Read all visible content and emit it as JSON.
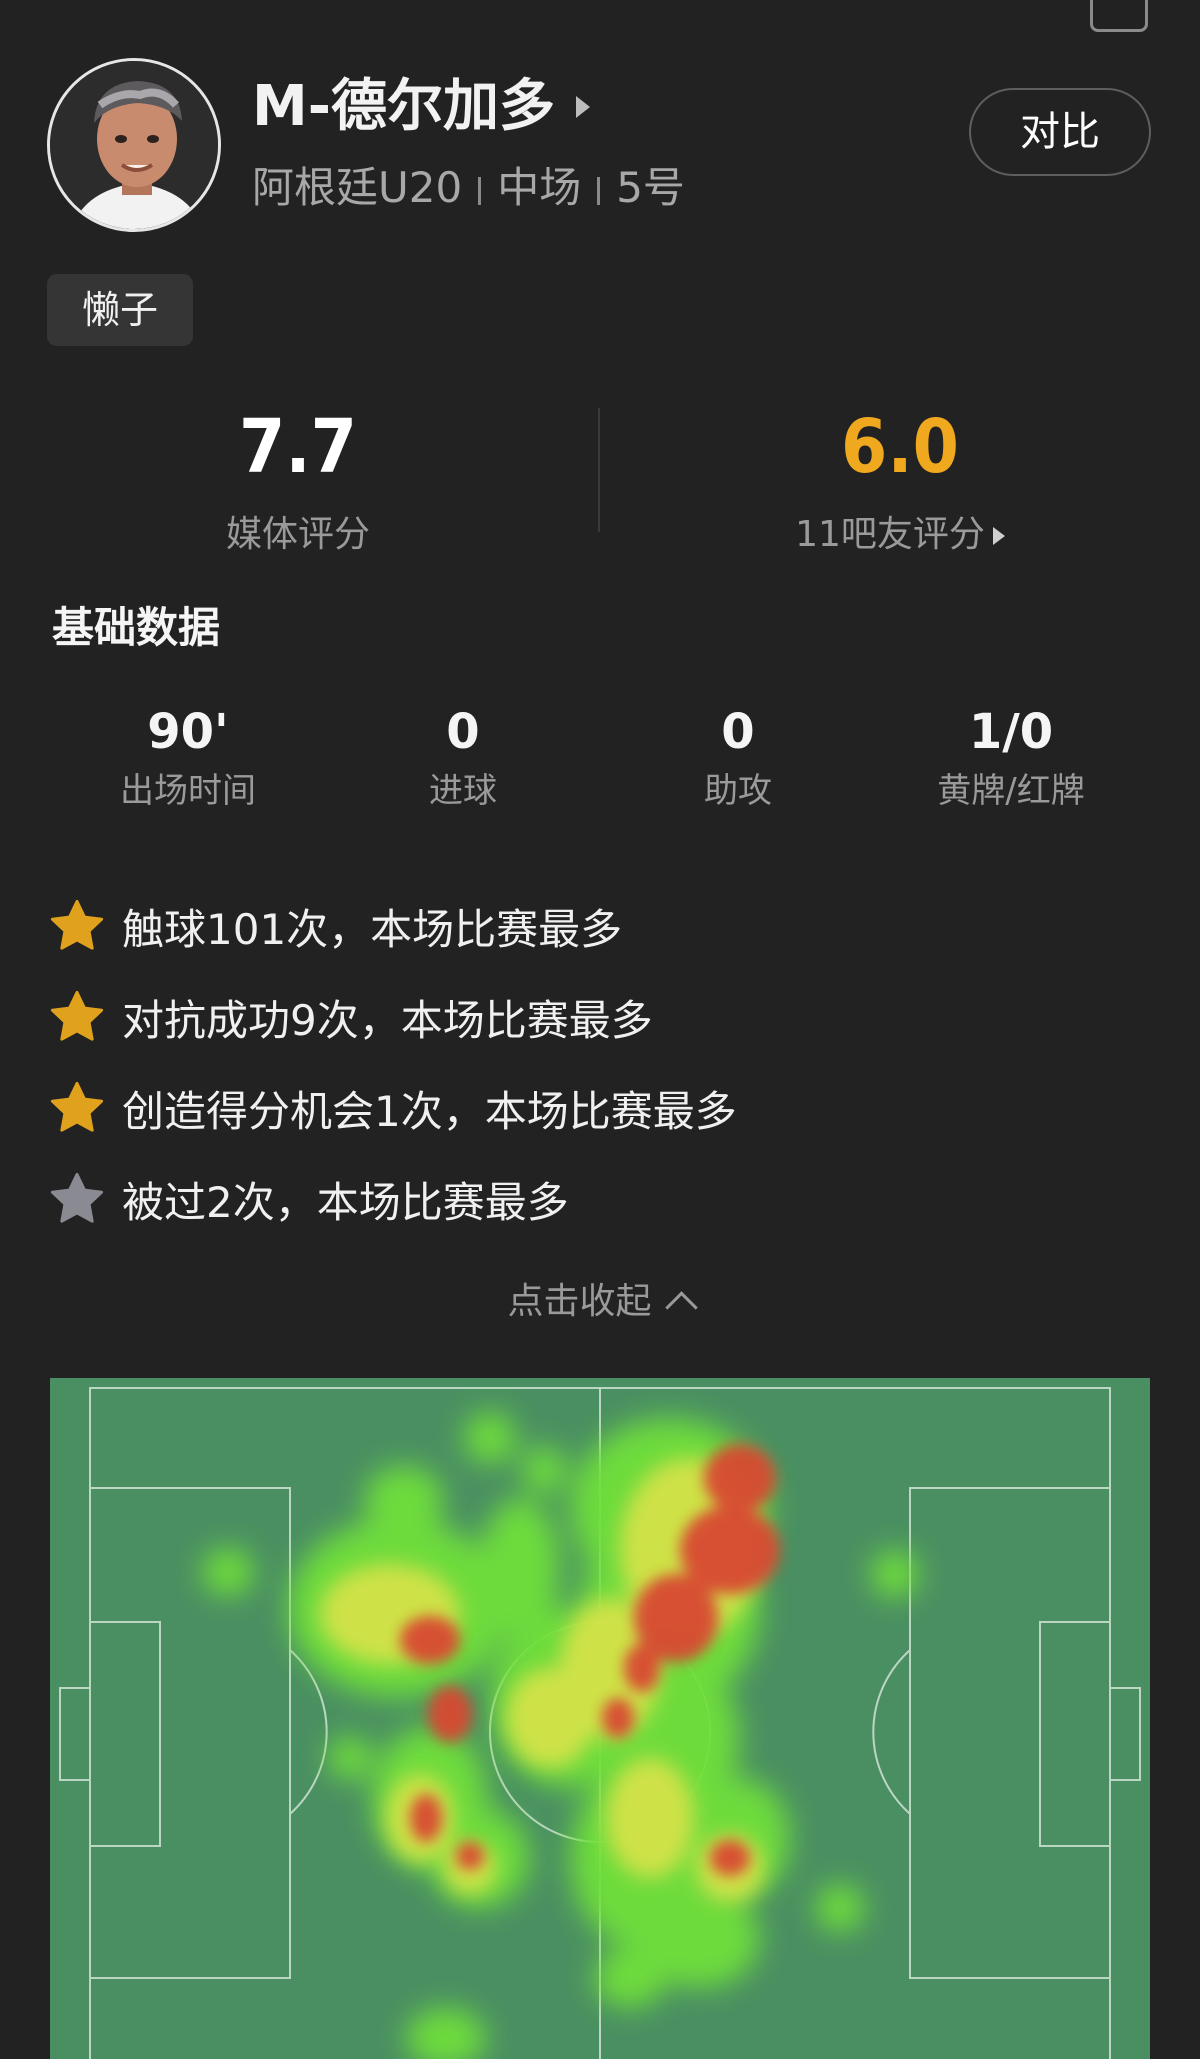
{
  "player": {
    "name": "M-德尔加多",
    "team": "阿根廷U20",
    "position": "中场",
    "number": "5号",
    "nickname": "懒子"
  },
  "actions": {
    "compare_label": "对比"
  },
  "ratings": {
    "media": {
      "value": "7.7",
      "label": "媒体评分",
      "color": "#ffffff"
    },
    "fans": {
      "value": "6.0",
      "label": "11吧友评分",
      "color": "#f0a81e"
    }
  },
  "basic": {
    "title": "基础数据",
    "stats": [
      {
        "value": "90'",
        "label": "出场时间"
      },
      {
        "value": "0",
        "label": "进球"
      },
      {
        "value": "0",
        "label": "助攻"
      },
      {
        "value": "1/0",
        "label": "黄牌/红牌"
      }
    ]
  },
  "highlights": [
    {
      "icon": "gold-star-icon",
      "color": "#e0a21c",
      "text": "触球101次，本场比赛最多"
    },
    {
      "icon": "gold-star-icon",
      "color": "#e0a21c",
      "text": "对抗成功9次，本场比赛最多"
    },
    {
      "icon": "gold-star-icon",
      "color": "#e0a21c",
      "text": "创造得分机会1次，本场比赛最多"
    },
    {
      "icon": "grey-star-icon",
      "color": "#8a8a93",
      "text": "被过2次，本场比赛最多"
    }
  ],
  "collapse_label": "点击收起",
  "heatmap": {
    "pitch_color": "#4a8f62",
    "line_color": "#cfe3d5"
  }
}
